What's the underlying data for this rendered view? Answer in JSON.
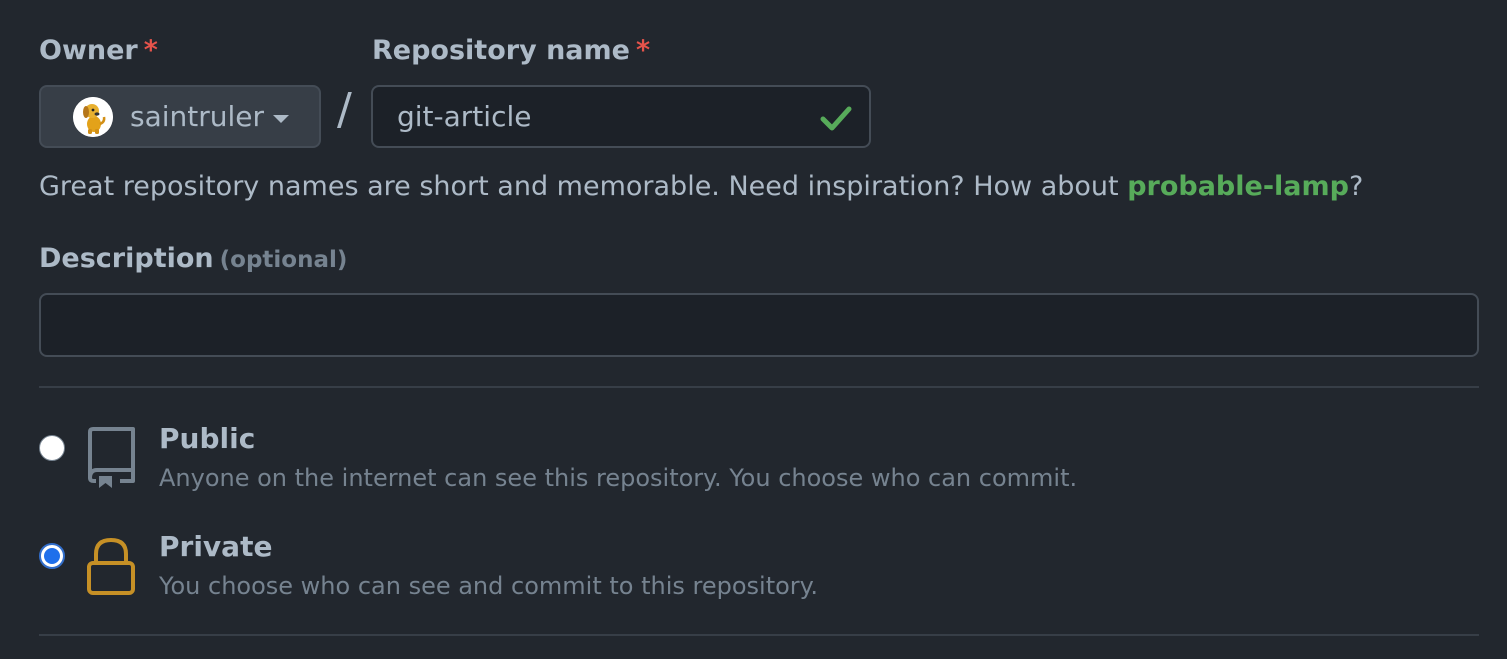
{
  "owner": {
    "label": "Owner",
    "required_mark": "*",
    "selected": "saintruler",
    "avatar_icon": "dog-avatar"
  },
  "separator": "/",
  "repository": {
    "label": "Repository name",
    "required_mark": "*",
    "value": "git-article",
    "valid_icon": "check-icon"
  },
  "hint": {
    "prefix": "Great repository names are short and memorable. Need inspiration? How about ",
    "suggestion": "probable-lamp",
    "suffix": "?"
  },
  "description": {
    "label": "Description",
    "optional": "(optional)",
    "value": "",
    "placeholder": ""
  },
  "visibility": {
    "selected": "private",
    "options": [
      {
        "id": "public",
        "title": "Public",
        "description": "Anyone on the internet can see this repository. You choose who can commit.",
        "icon": "repo-icon"
      },
      {
        "id": "private",
        "title": "Private",
        "description": "You choose who can see and commit to this repository.",
        "icon": "lock-icon"
      }
    ]
  },
  "colors": {
    "background": "#22272e",
    "required": "#e5534b",
    "success": "#57ab5a",
    "lock": "#c69026",
    "radio_selected": "#1f6feb"
  }
}
